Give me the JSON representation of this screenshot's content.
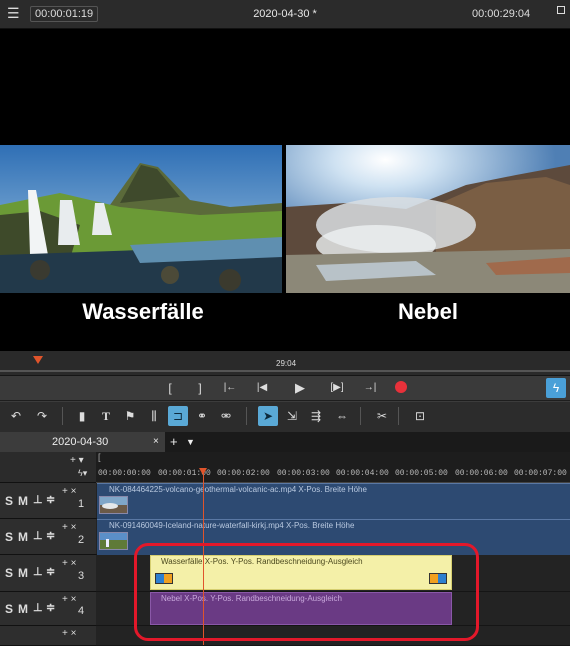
{
  "topbar": {
    "timecode_left": "00:00:01:19",
    "title": "2020-04-30 *",
    "timecode_right": "00:00:29:04"
  },
  "preview": {
    "left_caption": "Wasserfälle",
    "right_caption": "Nebel"
  },
  "position_bar": {
    "time_label": "29:04"
  },
  "transport": {
    "in_mark": "[",
    "out_mark": "]",
    "prev_marker": "|←",
    "prev_frame": "|◀",
    "play": "▶",
    "next_frame": "[▶]",
    "next_marker": "→|",
    "color_record": "#e8313a",
    "color_accent": "#4aa0d8"
  },
  "tabs": {
    "project_tab": "2020-04-30",
    "close": "×",
    "add": "+",
    "menu": "▼"
  },
  "timeline": {
    "ruler_bracket": "[",
    "ruler_labels": [
      "00:00:00:00",
      "00:00:01:00",
      "00:00:02:00",
      "00:00:03:00",
      "00:00:04:00",
      "00:00:05:00",
      "00:00:06:00",
      "00:00:07:00"
    ],
    "tracks": [
      {
        "s": "S",
        "m": "M",
        "number": "1",
        "clip": "NK-084464225-volcano-geothermal-volcanic-ac.mp4   X-Pos.  Breite  Höhe"
      },
      {
        "s": "S",
        "m": "M",
        "number": "2",
        "clip": "NK-091460049-Iceland-nature-waterfall-kirkj.mp4   X-Pos.  Breite  Höhe"
      },
      {
        "s": "S",
        "m": "M",
        "number": "3",
        "clip": "Wasserfälle   X-Pos.  Y-Pos.  Randbeschneidung-Ausgleich"
      },
      {
        "s": "S",
        "m": "M",
        "number": "4",
        "clip": "Nebel   X-Pos.  Y-Pos.  Randbeschneidung-Ausgleich"
      }
    ],
    "colors": {
      "video_clip": "#2d4a72",
      "title_clip_yellow": "#f4f0a8",
      "title_clip_purple": "#6a3a84",
      "playhead": "#e0542b",
      "highlight": "#e3182a"
    }
  }
}
